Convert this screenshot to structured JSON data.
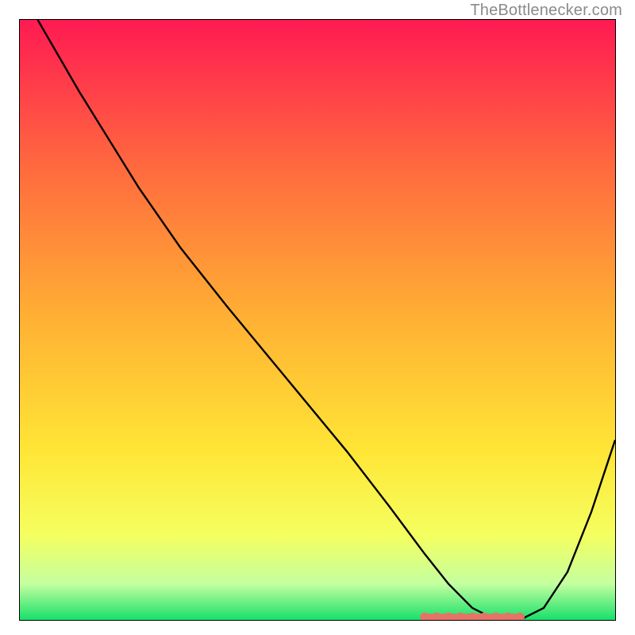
{
  "watermark": "TheBottlenecker.com",
  "chart_data": {
    "type": "line",
    "title": "",
    "xlabel": "",
    "ylabel": "",
    "xlim": [
      0,
      100
    ],
    "ylim": [
      0,
      100
    ],
    "grid": false,
    "background": {
      "type": "vertical-gradient",
      "stops": [
        {
          "pos": 0.0,
          "color": "#ff1a52"
        },
        {
          "pos": 0.25,
          "color": "#ff6b3e"
        },
        {
          "pos": 0.5,
          "color": "#ffb133"
        },
        {
          "pos": 0.72,
          "color": "#ffe636"
        },
        {
          "pos": 0.86,
          "color": "#f4ff60"
        },
        {
          "pos": 0.94,
          "color": "#c4ffa0"
        },
        {
          "pos": 1.0,
          "color": "#18e06a"
        }
      ]
    },
    "series": [
      {
        "name": "curve",
        "color": "#000000",
        "x": [
          3,
          10,
          20,
          27,
          35,
          45,
          55,
          62,
          68,
          72,
          76,
          80,
          84,
          88,
          92,
          96,
          100
        ],
        "y": [
          100,
          88,
          72,
          62,
          52,
          40,
          28,
          19,
          11,
          6,
          2,
          0,
          0,
          2,
          8,
          18,
          30
        ]
      },
      {
        "name": "flat-markers",
        "color": "#e57366",
        "type": "scatter",
        "x": [
          68,
          70,
          72,
          74,
          76,
          78,
          80,
          82,
          84
        ],
        "y": [
          0.5,
          0.5,
          0.5,
          0.5,
          0.5,
          0.5,
          0.5,
          0.5,
          0.5
        ]
      }
    ]
  }
}
